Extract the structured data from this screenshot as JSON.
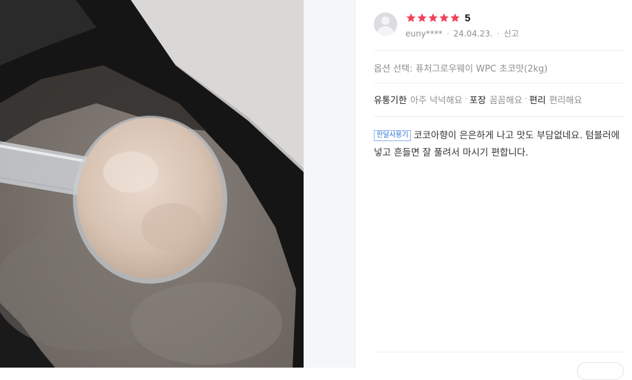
{
  "review": {
    "rating": "5",
    "rating_value": 5,
    "rating_max": 5,
    "star_color": "#f0425b",
    "author": "euny****",
    "date": "24.04.23.",
    "report_label": "신고",
    "option_label": "옵션 선택:",
    "option_value": "퓨처그로우웨이 WPC 초코맛(2kg)",
    "tags": [
      {
        "key": "유통기한",
        "value": "아주 넉넉해요"
      },
      {
        "key": "포장",
        "value": "꼼꼼해요"
      },
      {
        "key": "편리",
        "value": "편리해요"
      }
    ],
    "badge": "한달사용기",
    "content": "코코아향이 은은하게 나고 맛도 부담없네요. 텀블러에 넣고 흔들면 잘 풀려서 마시기 편합니다."
  },
  "photo": {
    "icon": "protein-powder-scoop-photo"
  }
}
